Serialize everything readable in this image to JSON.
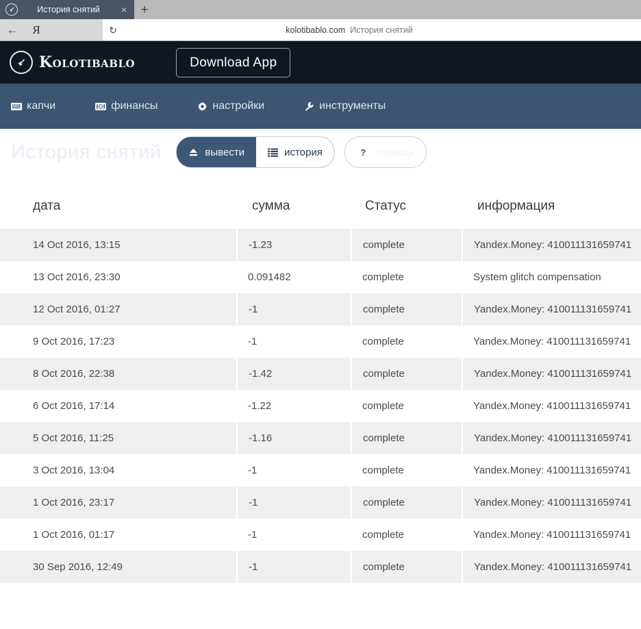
{
  "browser": {
    "tab_title": "История снятий",
    "favicon": "hammer-circle-icon",
    "close_label": "×",
    "new_tab_label": "+",
    "back_label": "←",
    "brand_mark": "Я",
    "reload_label": "↻",
    "address_domain": "kolotibablo.com",
    "address_title": "История снятий"
  },
  "site_header": {
    "logo_icon": "hammer-circle-icon",
    "logo_text": "Kolotibablo",
    "download_app_label": "Download App"
  },
  "nav": {
    "items": [
      {
        "label": "капчи",
        "icon": "keyboard-icon",
        "glyph": "⌨"
      },
      {
        "label": "финансы",
        "icon": "banknote-icon",
        "glyph": "▤"
      },
      {
        "label": "настройки",
        "icon": "gear-icon",
        "glyph": "⚙"
      },
      {
        "label": "инструменты",
        "icon": "wrench-icon",
        "glyph": "🔧"
      }
    ]
  },
  "page": {
    "title": "История снятий",
    "buttons": [
      {
        "label": "вывести",
        "icon": "eject-icon",
        "glyph": "⏏",
        "active": false
      },
      {
        "label": "история",
        "icon": "list-icon",
        "glyph": "☰",
        "active": true
      }
    ],
    "help_button": {
      "label": "помощь",
      "icon": "question-mark-icon",
      "glyph": "?"
    }
  },
  "table": {
    "columns": [
      "дата",
      "сумма",
      "Статус",
      "информация"
    ],
    "rows": [
      {
        "date": "14 Oct 2016, 13:15",
        "amount": "-1.23",
        "status": "complete",
        "info": "Yandex.Money: 410011131659741"
      },
      {
        "date": "13 Oct 2016, 23:30",
        "amount": "0.091482",
        "status": "complete",
        "info": "System glitch compensation"
      },
      {
        "date": "12 Oct 2016, 01:27",
        "amount": "-1",
        "status": "complete",
        "info": "Yandex.Money: 410011131659741"
      },
      {
        "date": "9 Oct 2016, 17:23",
        "amount": "-1",
        "status": "complete",
        "info": "Yandex.Money: 410011131659741"
      },
      {
        "date": "8 Oct 2016, 22:38",
        "amount": "-1.42",
        "status": "complete",
        "info": "Yandex.Money: 410011131659741"
      },
      {
        "date": "6 Oct 2016, 17:14",
        "amount": "-1.22",
        "status": "complete",
        "info": "Yandex.Money: 410011131659741"
      },
      {
        "date": "5 Oct 2016, 11:25",
        "amount": "-1.16",
        "status": "complete",
        "info": "Yandex.Money: 410011131659741"
      },
      {
        "date": "3 Oct 2016, 13:04",
        "amount": "-1",
        "status": "complete",
        "info": "Yandex.Money: 410011131659741"
      },
      {
        "date": "1 Oct 2016, 23:17",
        "amount": "-1",
        "status": "complete",
        "info": "Yandex.Money: 410011131659741"
      },
      {
        "date": "1 Oct 2016, 01:17",
        "amount": "-1",
        "status": "complete",
        "info": "Yandex.Money: 410011131659741"
      },
      {
        "date": "30 Sep 2016, 12:49",
        "amount": "-1",
        "status": "complete",
        "info": "Yandex.Money: 410011131659741"
      }
    ]
  },
  "colors": {
    "topbar": "#111721",
    "navbar": "#3b5572",
    "banner_top": "#3a5270",
    "banner_bottom": "#5b7a9b",
    "row_stripe": "#efefef",
    "tab_active_bg": "#ffffff"
  }
}
